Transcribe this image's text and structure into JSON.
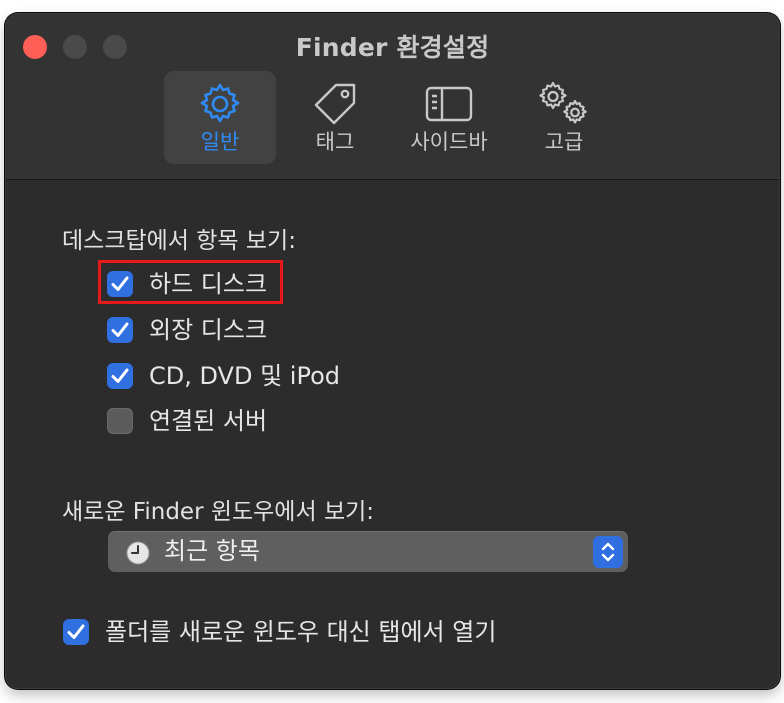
{
  "window": {
    "title": "Finder 환경설정"
  },
  "toolbar": {
    "tabs": [
      {
        "label": "일반",
        "icon": "gear-icon",
        "selected": true
      },
      {
        "label": "태그",
        "icon": "tag-icon",
        "selected": false
      },
      {
        "label": "사이드바",
        "icon": "sidebar-icon",
        "selected": false
      },
      {
        "label": "고급",
        "icon": "gears-icon",
        "selected": false
      }
    ]
  },
  "desktop": {
    "heading": "데스크탑에서 항목 보기:",
    "items": [
      {
        "label": "하드 디스크",
        "checked": true
      },
      {
        "label": "외장 디스크",
        "checked": true
      },
      {
        "label": "CD, DVD 및 iPod",
        "checked": true
      },
      {
        "label": "연결된 서버",
        "checked": false
      }
    ]
  },
  "new_window": {
    "heading": "새로운 Finder 윈도우에서 보기:",
    "selected": "최근 항목",
    "icon": "clock-icon"
  },
  "open_folders": {
    "label": "폴더를 새로운 윈도우 대신 탭에서 열기",
    "checked": true
  },
  "colors": {
    "accent": "#2f6fe0",
    "selected_tab_text": "#2f8bf4",
    "highlight": "#e8191a",
    "close_button": "#fe5f57"
  }
}
